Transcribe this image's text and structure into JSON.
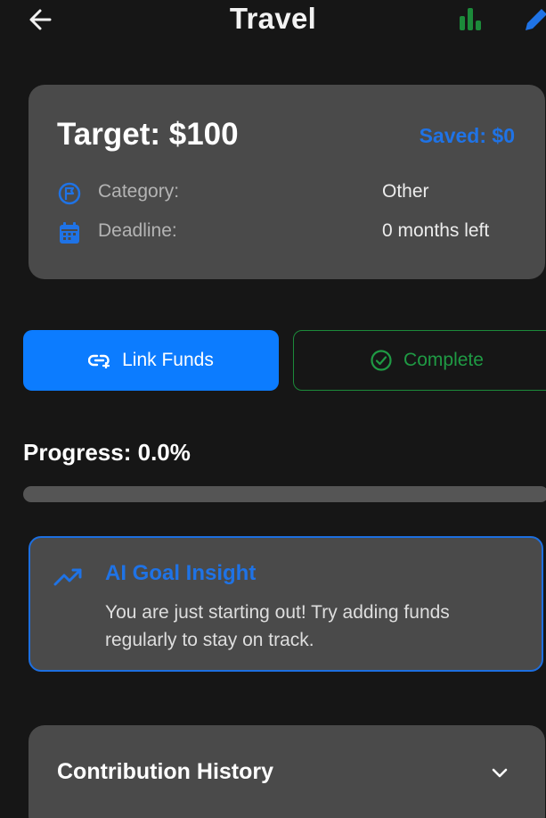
{
  "header": {
    "title": "Travel",
    "back_icon": "arrow-left-icon",
    "stats_icon": "bar-chart-icon",
    "edit_icon": "pencil-icon"
  },
  "summary": {
    "target": "Target: $100",
    "saved": "Saved: $0",
    "category_label": "Category:",
    "category_value": "Other",
    "category_icon": "category-icon",
    "deadline_label": "Deadline:",
    "deadline_value": "0 months left",
    "deadline_icon": "calendar-icon"
  },
  "actions": {
    "link_funds": "Link Funds",
    "link_icon": "link-icon",
    "complete": "Complete",
    "complete_icon": "check-circle-icon"
  },
  "progress": {
    "label": "Progress: 0.0%",
    "fraction": 0.0
  },
  "insight": {
    "title": "AI Goal Insight",
    "text": "You are just starting out! Try adding funds regularly to stay on track.",
    "icon": "trending-up-icon"
  },
  "history": {
    "title": "Contribution History",
    "icon": "chevron-down-icon"
  },
  "colors": {
    "background": "#161616",
    "card": "#4a4a4a",
    "accent_blue": "#1f73e6",
    "button_blue": "#0c7cff",
    "success_green": "#1f9a44"
  }
}
